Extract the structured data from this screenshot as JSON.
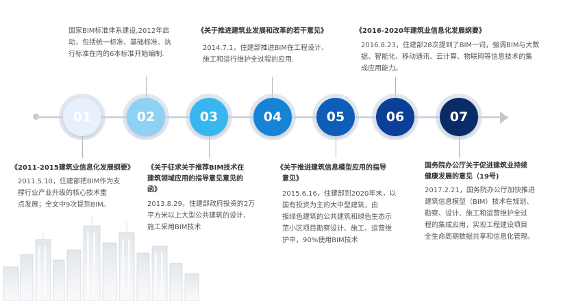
{
  "nodes": [
    {
      "num": "01",
      "color": "#e6f1fb"
    },
    {
      "num": "02",
      "color": "#8fd0f5"
    },
    {
      "num": "03",
      "color": "#38b6ef"
    },
    {
      "num": "04",
      "color": "#1583d6"
    },
    {
      "num": "05",
      "color": "#0e5db8"
    },
    {
      "num": "06",
      "color": "#0c3f97"
    },
    {
      "num": "07",
      "color": "#0b2b67"
    }
  ],
  "items": [
    {
      "title": "《2011-2015建筑业信息化发展纲要》",
      "date": "2011.5.10，住建部把BIM作为支",
      "lines": [
        "撑行业产业升级的核心技术重",
        "点发展；全文中9次提到BIM。"
      ]
    },
    {
      "title": "",
      "date": "国家BIM标准体系建设,2012年启",
      "lines": [
        "动，包括统一标准、基础标准、执",
        "行标准在内的6本标准开始编制."
      ]
    },
    {
      "title": "《关于征求关于推荐BIM技术在",
      "title2": "建筑领域应用的指导意见意见的",
      "title3": "函》",
      "date": "2013.8.29，住建部政府投资的2万",
      "lines": [
        "平方米以上大型公共建筑的设计、",
        "施工采用BIM技术"
      ]
    },
    {
      "title": "《关于推进建筑业发展和改革的若干意见》",
      "date": "2014.7.1，住建部推进BIM在工程设计、",
      "lines": [
        "施工和运行维护全过程的应用."
      ]
    },
    {
      "title": "《关于推进建筑信息模型应用的指导",
      "title2": "意见》",
      "date": "2015.6.16，住建部到2020年末，以",
      "lines": [
        "国有投资为主的大中型建筑，由",
        "报绿色建筑的公共建筑和绿色生态示",
        "范小区项目勘察设计、施工、运营维",
        "护中，90%使用BIM技术"
      ]
    },
    {
      "title": "《2016-2020年建筑业信息化发展纲要》",
      "date": "2016.8.23，住建部28次提到了BIM一词，强调BIM与大数",
      "lines": [
        "据、智能化、移动通讯、云计算、物联网等信息技术的集",
        "成应用能力。"
      ]
    },
    {
      "title": "国务院办公厅关于促进建筑业持续",
      "title2": "健康发展的意见（19号)",
      "date": "2017.2.21，国务院办公厅加快推进",
      "lines": [
        "建筑信息模型（BIM）技术在规划、",
        "勘察、设计、施工和运营维护全过",
        "程的集成应用，实现工程建设项目",
        "全生命周期数据共享和信息化管理。"
      ]
    }
  ]
}
